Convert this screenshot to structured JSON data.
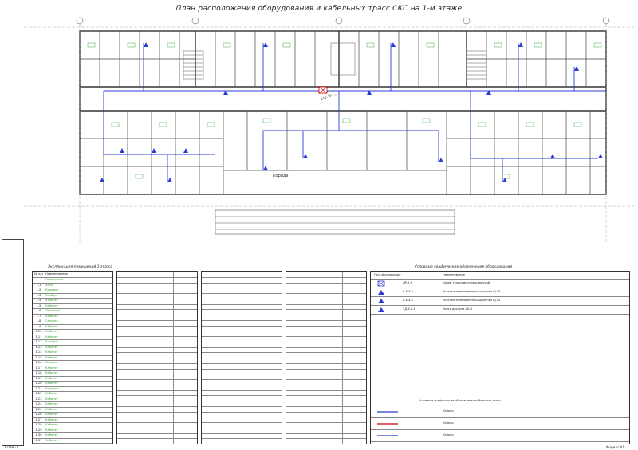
{
  "drawing": {
    "title": "План расположения оборудования и кабельных трасс СКС на 1-м этаже",
    "annotation": "стр. Ш. ...",
    "street_label": "Корида",
    "sheet_left_bottom": "КЛ ВК-1",
    "sheet_right_bottom": "Формат А1"
  },
  "room_table": {
    "title": "Экспликация помещений 1 этажа",
    "headers": [
      "№ п/п",
      "Наименование"
    ],
    "rows": [
      [
        "",
        "Помещения"
      ],
      [
        "1.1",
        "Холл"
      ],
      [
        "1.2",
        "Коридор"
      ],
      [
        "1.3",
        "Тамбур"
      ],
      [
        "1.4",
        "Кабинет"
      ],
      [
        "1.5",
        "Кабинет"
      ],
      [
        "1.6",
        "Лестница"
      ],
      [
        "1.7",
        "Кабинет"
      ],
      [
        "1.8",
        "Санузел"
      ],
      [
        "1.9",
        "Кабинет"
      ],
      [
        "1.10",
        "Кабинет"
      ],
      [
        "1.11",
        "Кабинет"
      ],
      [
        "1.12",
        "Коридор"
      ],
      [
        "1.13",
        "Кабинет"
      ],
      [
        "1.14",
        "Кабинет"
      ],
      [
        "1.15",
        "Кабинет"
      ],
      [
        "1.16",
        "Санузел"
      ],
      [
        "1.17",
        "Кабинет"
      ],
      [
        "1.18",
        "Кабинет"
      ],
      [
        "1.19",
        "Кабинет"
      ],
      [
        "1.20",
        "Кабинет"
      ],
      [
        "1.21",
        "Коридор"
      ],
      [
        "1.22",
        "Кабинет"
      ],
      [
        "1.23",
        "Кабинет"
      ],
      [
        "1.24",
        "Кабинет"
      ],
      [
        "1.25",
        "Кабинет"
      ],
      [
        "1.26",
        "Кабинет"
      ],
      [
        "1.27",
        "Кабинет"
      ],
      [
        "1.28",
        "Кабинет"
      ],
      [
        "1.29",
        "Кабинет"
      ],
      [
        "1.30",
        "Кабинет"
      ],
      [
        "1.31",
        "Кабинет"
      ]
    ]
  },
  "legend": {
    "title": "Условные графические обозначения оборудования",
    "headers": [
      "Поз. обозначение",
      "Наименование"
    ],
    "items": [
      {
        "code": "ЛР-5.5",
        "text": "Шкаф телекоммуникационный"
      },
      {
        "code": "Р-Х.Х.Х",
        "text": "Розетка телекоммуникационная RJ-45"
      },
      {
        "code": "Р-Х.Х.Х",
        "text": "Розетка телекоммуникационная RJ-45"
      },
      {
        "code": "ТД-Х.Х.Х",
        "text": "Точка доступа Wi-Fi"
      }
    ],
    "cable_title": "Условные графические обозначения кабельных трасс",
    "cable_items": [
      {
        "code": "",
        "text": "Кабель"
      },
      {
        "code": "",
        "text": "Кабель"
      },
      {
        "code": "",
        "text": "Кабель"
      }
    ]
  },
  "colors": {
    "plan_line": "#333333",
    "cable": "#2b3bd4",
    "room_tag": "#3aa83a",
    "wall_fill": "#777777"
  }
}
